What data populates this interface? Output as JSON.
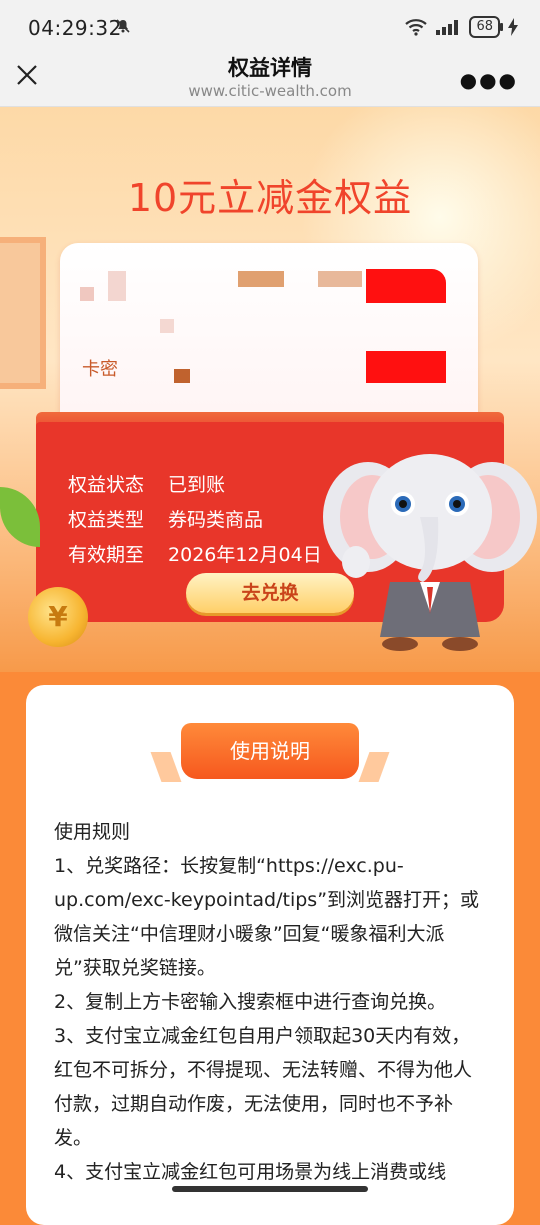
{
  "status_bar": {
    "time": "04:29:32",
    "battery": "68"
  },
  "nav": {
    "title": "权益详情",
    "url": "www.citic-wealth.com"
  },
  "hero": {
    "title": "10元立减金权益",
    "card_key_label": "卡密",
    "info": [
      {
        "label": "权益状态",
        "value": "已到账"
      },
      {
        "label": "权益类型",
        "value": "券码类商品"
      },
      {
        "label": "有效期至",
        "value": "2026年12月04日"
      }
    ],
    "redeem_button": "去兑换",
    "coin_symbol": "¥"
  },
  "rules": {
    "tab_label": "使用说明",
    "heading": "使用规则",
    "items": [
      "1、兑奖路径：长按复制“https://exc.pu-up.com/exc-keypointad/tips”到浏览器打开；或微信关注“中信理财小暖象”回复“暖象福利大派兑”获取兑奖链接。",
      "2、复制上方卡密输入搜索框中进行查询兑换。",
      "3、支付宝立减金红包自用户领取起30天内有效，红包不可拆分，不得提现、无法转赠、不得为他人付款，过期自动作废，无法使用，同时也不予补发。",
      "4、支付宝立减金红包可用场景为线上消费或线"
    ]
  },
  "colors": {
    "accent_red": "#e8362a",
    "title_red": "#f0442b",
    "orange": "#fb8a38"
  }
}
